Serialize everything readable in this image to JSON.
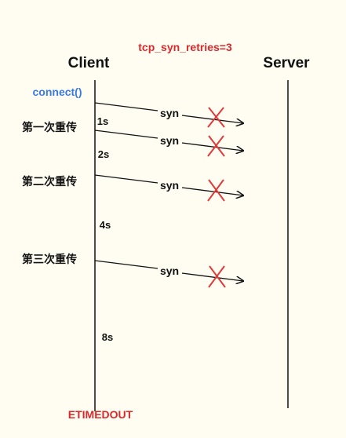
{
  "config": {
    "label": "tcp_syn_retries=3",
    "color": "#d9292b"
  },
  "participants": {
    "client": "Client",
    "server": "Server"
  },
  "call": {
    "label": "connect()",
    "color": "#3a7be0"
  },
  "retransmissions": [
    {
      "label": "第一次重传"
    },
    {
      "label": "第二次重传"
    },
    {
      "label": "第三次重传"
    }
  ],
  "intervals": [
    "1s",
    "2s",
    "4s",
    "8s"
  ],
  "message": {
    "label": "syn",
    "lost_marker_color": "#e03a3a"
  },
  "result": {
    "label": "ETIMEDOUT",
    "color": "#d9292b"
  },
  "colors": {
    "background": "#fffdf2",
    "line": "#111111"
  }
}
